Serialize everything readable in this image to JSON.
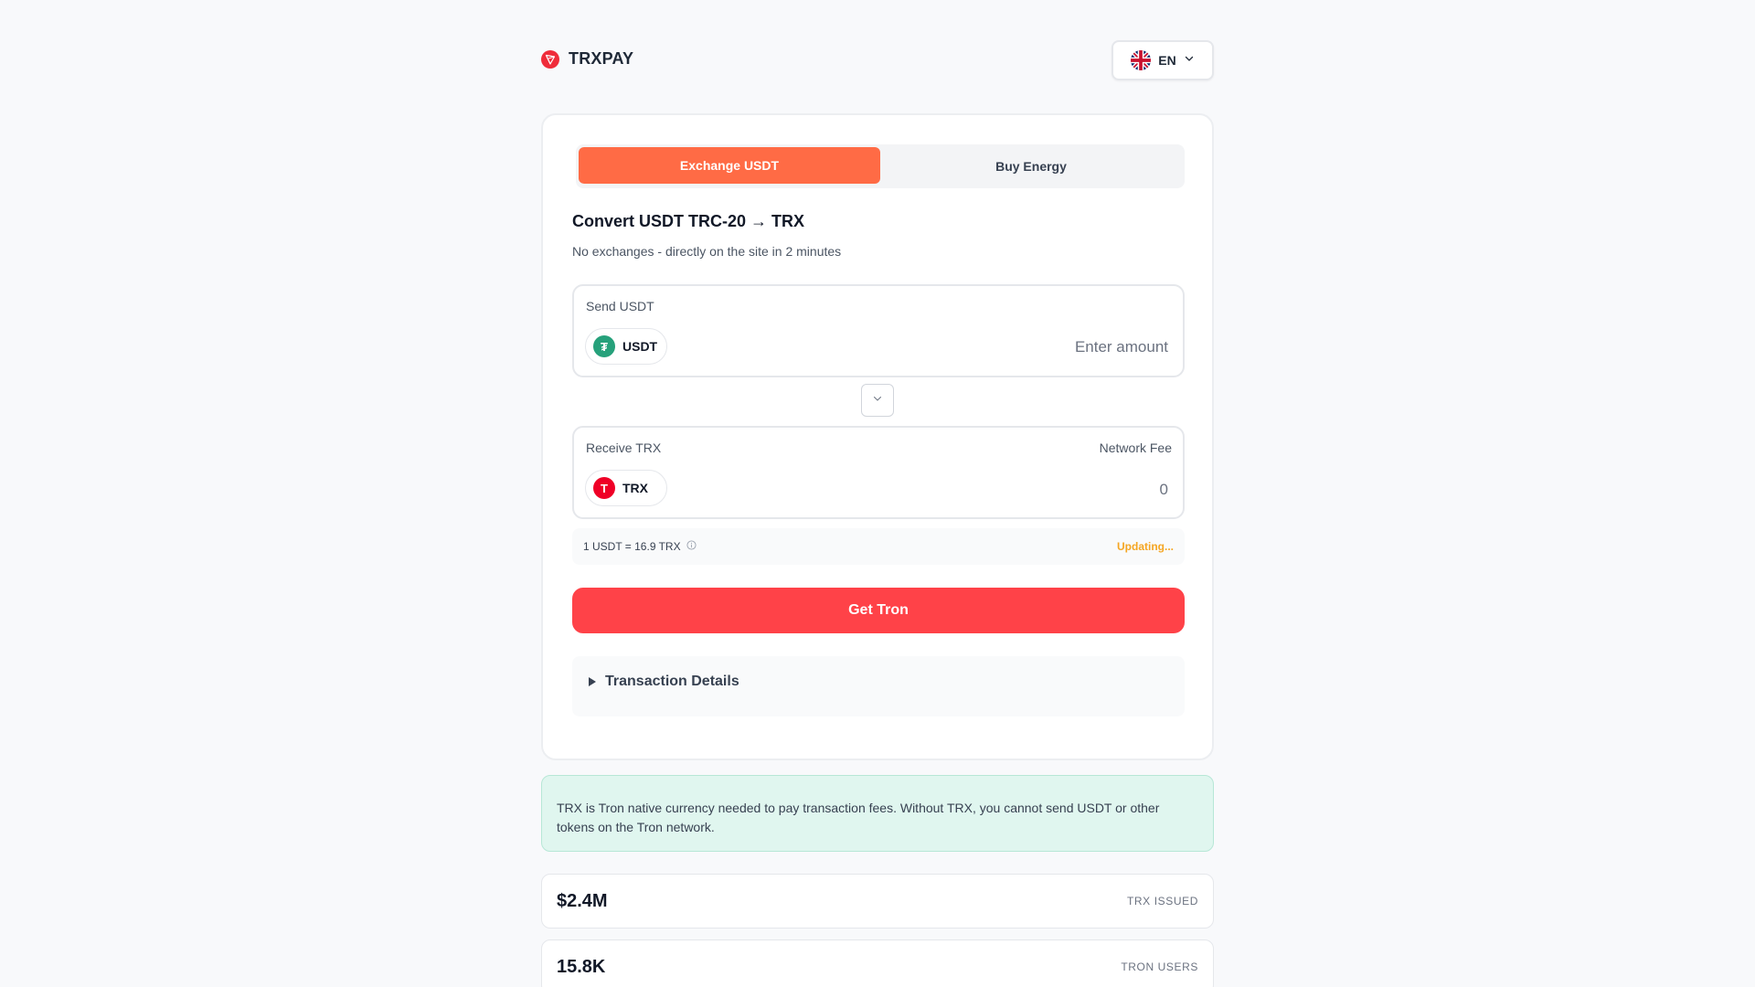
{
  "brand": {
    "name": "TRXPAY"
  },
  "language": {
    "code": "EN"
  },
  "tabs": [
    {
      "label": "Exchange USDT",
      "active": true
    },
    {
      "label": "Buy Energy",
      "active": false
    }
  ],
  "converter": {
    "title": "Convert USDT TRC-20 → TRX",
    "subtitle": "No exchanges - directly on the site in 2 minutes",
    "send": {
      "label": "Send USDT",
      "token": "USDT",
      "placeholder": "Enter amount",
      "value": ""
    },
    "receive": {
      "label": "Receive TRX",
      "right_label": "Network Fee",
      "token": "TRX",
      "value": "0"
    },
    "rate": {
      "text": "1 USDT = 16.9 TRX",
      "status": "Updating..."
    },
    "cta_label": "Get Tron",
    "details_label": "Transaction Details"
  },
  "info": "TRX is Tron native currency needed to pay transaction fees. Without TRX, you cannot send USDT or other tokens on the Tron network.",
  "stats": [
    {
      "value": "$2.4M",
      "label": "TRX ISSUED"
    },
    {
      "value": "15.8K",
      "label": "TRON USERS"
    }
  ],
  "colors": {
    "accent_tab": "#ff6b45",
    "cta": "#ff4248",
    "status": "#f5a623",
    "usdt": "#26a17b",
    "trx": "#ef0027"
  }
}
